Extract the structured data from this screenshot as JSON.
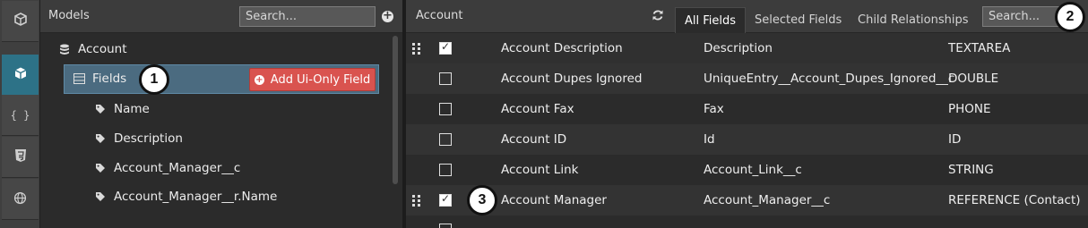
{
  "rail": {
    "items": [
      {
        "icon": "cube-stack-icon",
        "glyph": "❒"
      },
      {
        "icon": "cube-icon",
        "glyph": "⬢",
        "active": true
      },
      {
        "icon": "braces-icon",
        "glyph": "{ }"
      },
      {
        "icon": "css3-icon",
        "glyph": "3"
      },
      {
        "icon": "globe-icon",
        "glyph": "⊕"
      }
    ]
  },
  "models": {
    "title": "Models",
    "search_placeholder": "Search...",
    "tree": {
      "root": "Account",
      "fields_label": "Fields",
      "add_button": "Add Ui-Only Field",
      "children": [
        "Name",
        "Description",
        "Account_Manager__c",
        "Account_Manager__r.Name"
      ]
    }
  },
  "callouts": {
    "one": "1",
    "two": "2",
    "three": "3"
  },
  "fields_panel": {
    "title": "Account",
    "tabs": [
      "All Fields",
      "Selected Fields",
      "Child Relationships"
    ],
    "search_placeholder": "Search...",
    "rows": [
      {
        "label": "Account Description",
        "api": "Description",
        "type": "TEXTAREA",
        "checked": true
      },
      {
        "label": "Account Dupes Ignored",
        "api": "UniqueEntry__Account_Dupes_Ignored__c",
        "type": "DOUBLE",
        "checked": false
      },
      {
        "label": "Account Fax",
        "api": "Fax",
        "type": "PHONE",
        "checked": false
      },
      {
        "label": "Account ID",
        "api": "Id",
        "type": "ID",
        "checked": false
      },
      {
        "label": "Account Link",
        "api": "Account_Link__c",
        "type": "STRING",
        "checked": false
      },
      {
        "label": "Account Manager",
        "api": "Account_Manager__c",
        "type": "REFERENCE (Contact)",
        "checked": true
      }
    ]
  },
  "colors": {
    "rail_active": "#2d7287",
    "selected_row": "#4b6b80",
    "add_button": "#d9534f"
  }
}
